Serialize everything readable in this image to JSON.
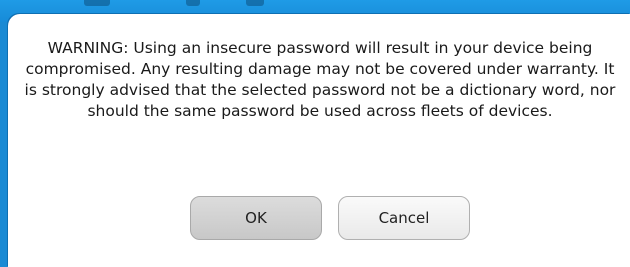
{
  "dialog": {
    "message": "WARNING: Using an insecure password will result in your device being compromised. Any resulting damage may not be covered under warranty. It is strongly advised that the selected password not be a dictionary word, nor should the same password be used across fleets of devices.",
    "ok_label": "OK",
    "cancel_label": "Cancel"
  },
  "colors": {
    "background": "#1a8ad4",
    "dialog": "#ffffff",
    "ok_button": "#d2d2d2",
    "cancel_button": "#f2f2f2"
  }
}
